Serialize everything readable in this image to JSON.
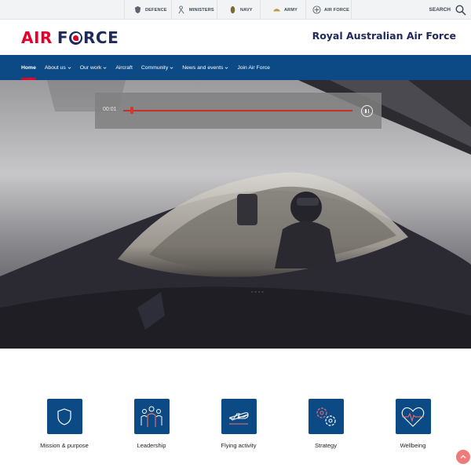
{
  "utility_bar": {
    "links": [
      {
        "label": "DEFENCE",
        "icon": "defence-crest-icon"
      },
      {
        "label": "MINISTERS",
        "icon": "ministers-icon"
      },
      {
        "label": "NAVY",
        "icon": "navy-crest-icon"
      },
      {
        "label": "ARMY",
        "icon": "army-crest-icon"
      },
      {
        "label": "AIR FORCE",
        "icon": "air-force-crest-icon"
      }
    ],
    "search_label": "SEARCH"
  },
  "header": {
    "logo_air": "AIR",
    "logo_force_f": "F",
    "logo_force_rest": "RCE",
    "site_title": "Royal Australian Air Force"
  },
  "nav": {
    "items": [
      {
        "label": "Home",
        "active": true,
        "dropdown": false
      },
      {
        "label": "About us",
        "active": false,
        "dropdown": true
      },
      {
        "label": "Our work",
        "active": false,
        "dropdown": true
      },
      {
        "label": "Aircraft",
        "active": false,
        "dropdown": false
      },
      {
        "label": "Community",
        "active": false,
        "dropdown": true
      },
      {
        "label": "News and events",
        "active": false,
        "dropdown": true
      },
      {
        "label": "Join Air Force",
        "active": false,
        "dropdown": false
      }
    ]
  },
  "video": {
    "time": "00:01",
    "progress": 0.03,
    "state": "playing"
  },
  "tiles": [
    {
      "label": "Mission & purpose",
      "icon": "shield-icon"
    },
    {
      "label": "Leadership",
      "icon": "people-icon"
    },
    {
      "label": "Flying activity",
      "icon": "airplane-icon"
    },
    {
      "label": "Strategy",
      "icon": "gears-icon"
    },
    {
      "label": "Wellbeing",
      "icon": "heart-pulse-icon"
    }
  ],
  "colors": {
    "brand_red": "#e4002b",
    "brand_navy": "#1f2a5a",
    "nav_blue": "#0c4a86",
    "accent_red": "#f07a7a"
  }
}
